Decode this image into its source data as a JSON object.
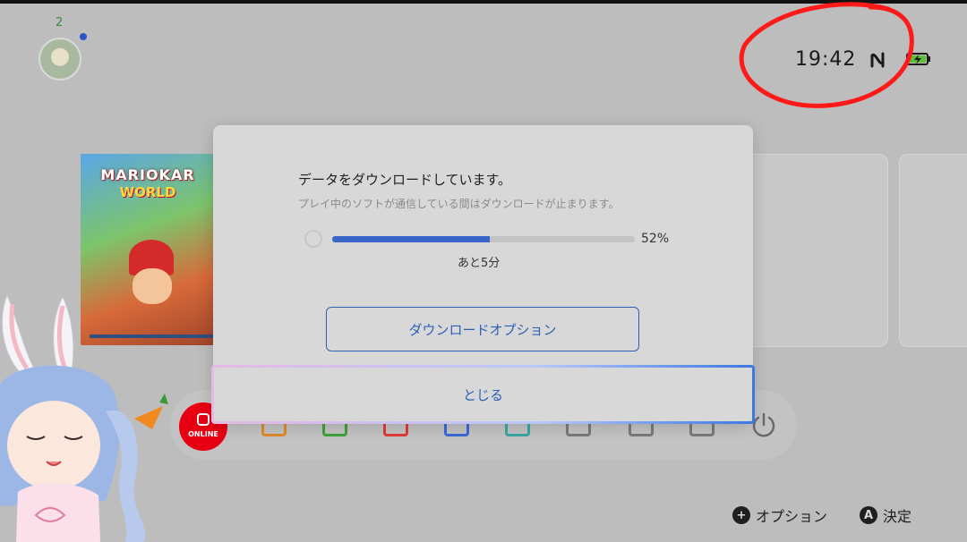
{
  "user": {
    "count": "2"
  },
  "status": {
    "time": "19:42",
    "wifi_icon": "wifi-signal-icon",
    "battery_icon": "battery-charging-icon"
  },
  "game": {
    "title": "MARIOKAR",
    "subtitle": "WORLD"
  },
  "dock": {
    "online_label": "ONLINE"
  },
  "dialog": {
    "title": "データをダウンロードしています。",
    "subtitle": "プレイ中のソフトが通信している間はダウンロードが止まります。",
    "progress_percent": 52,
    "progress_text": "52%",
    "remaining": "あと5分",
    "option_button": "ダウンロードオプション",
    "close_button": "とじる"
  },
  "footer": {
    "options_glyph": "+",
    "options_label": "オプション",
    "confirm_glyph": "A",
    "confirm_label": "決定"
  },
  "colors": {
    "accent": "#3967c9",
    "annotation_red": "#ff1a1a",
    "online_red": "#e60012"
  }
}
